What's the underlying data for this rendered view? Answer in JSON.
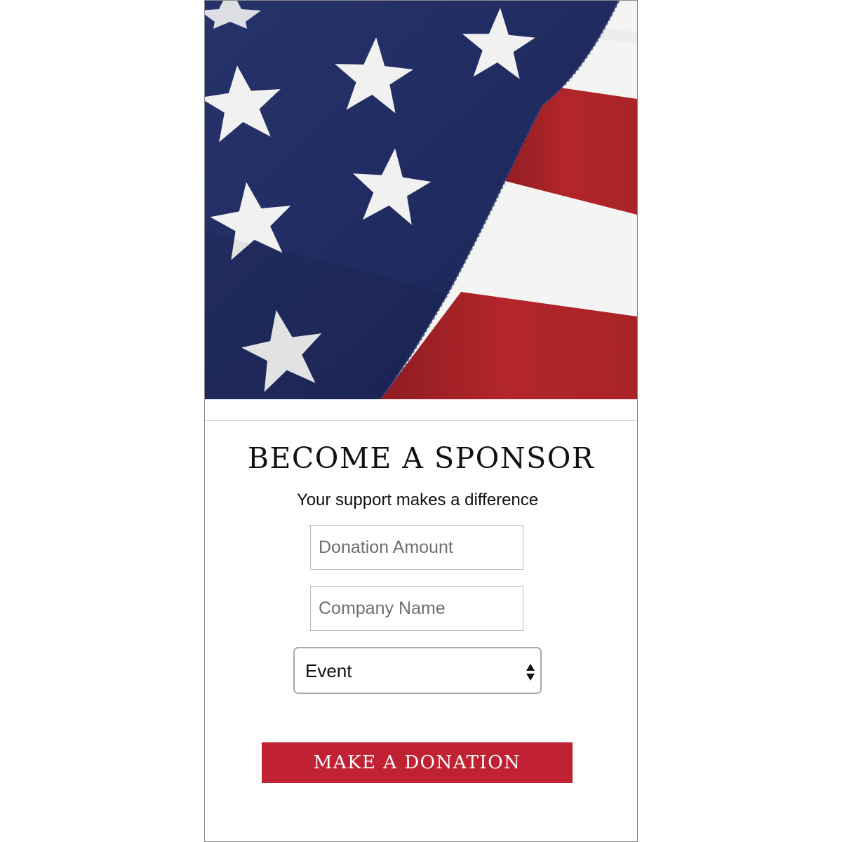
{
  "hero": {
    "image": "american-flag-photo",
    "colors": {
      "canton": "#1f2a5e",
      "stripe_red": "#b3262a",
      "stripe_white": "#f4f4f2",
      "star": "#f1f1f1"
    }
  },
  "form": {
    "title": "BECOME A SPONSOR",
    "subtitle": "Your support makes a difference",
    "donation_amount_placeholder": "Donation Amount",
    "company_name_placeholder": "Company Name",
    "event_select_value": "Event",
    "submit_label": "MAKE A DONATION"
  },
  "colors": {
    "button_background": "#c12233",
    "button_text": "#ffffff"
  }
}
